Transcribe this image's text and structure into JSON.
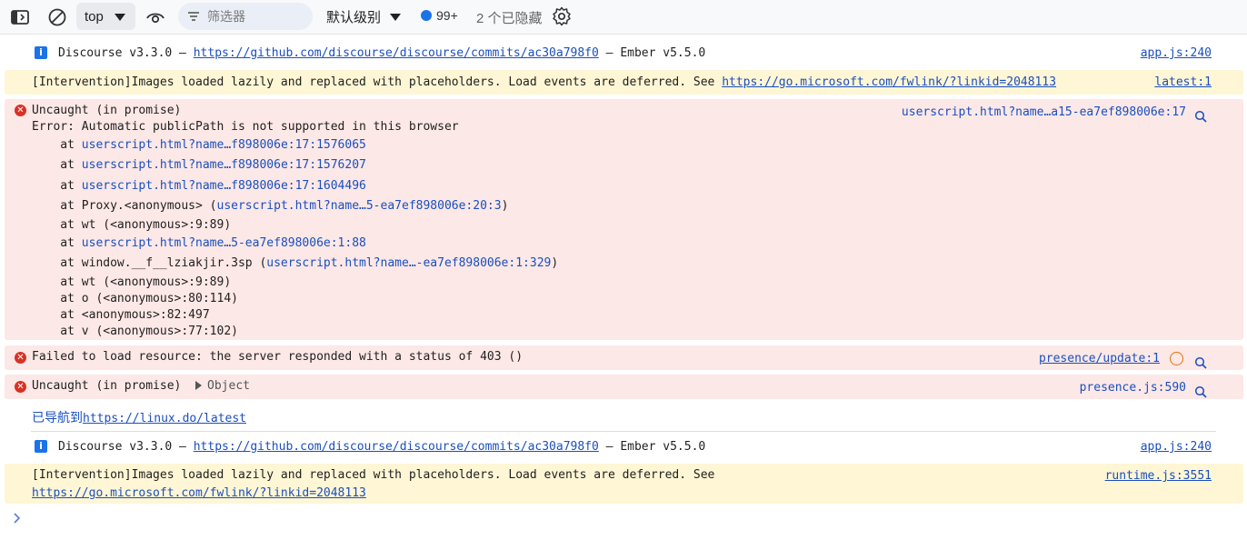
{
  "toolbar": {
    "context": "top",
    "filter_placeholder": "筛选器",
    "level": "默认级别",
    "issues_count": "99+",
    "hidden": "2 个已隐藏"
  },
  "messages": {
    "m1": {
      "text": "Discourse v3.3.0 — ",
      "link": "https://github.com/discourse/discourse/commits/ac30a798f0",
      "tail": " — Ember v5.5.0",
      "source": "app.js:240"
    },
    "m2": {
      "text": "[Intervention]Images loaded lazily and replaced with placeholders. Load events are deferred. See ",
      "link": "https://go.microsoft.com/fwlink/?linkid=2048113",
      "source": "latest:1"
    },
    "m3": {
      "title": "Uncaught (in promise)",
      "error": "Error: Automatic publicPath is not supported in this browser",
      "source": "userscript.html?name…a15-ea7ef898006e:17",
      "stack": {
        "s1": {
          "pre": "    at ",
          "link": "userscript.html?name…f898006e:17:1576065",
          "post": ""
        },
        "s2": {
          "pre": "    at ",
          "link": "userscript.html?name…f898006e:17:1576207",
          "post": ""
        },
        "s3": {
          "pre": "    at ",
          "link": "userscript.html?name…f898006e:17:1604496",
          "post": ""
        },
        "s4": {
          "pre": "    at Proxy.<anonymous> (",
          "link": "userscript.html?name…5-ea7ef898006e:20:3",
          "post": ")"
        },
        "s5": {
          "pre": "    at wt (<anonymous>:9:89)",
          "link": "",
          "post": ""
        },
        "s6": {
          "pre": "    at ",
          "link": "userscript.html?name…5-ea7ef898006e:1:88",
          "post": ""
        },
        "s7": {
          "pre": "    at window.__f__lziakjir.3sp (",
          "link": "userscript.html?name…-ea7ef898006e:1:329",
          "post": ")"
        },
        "s8": {
          "pre": "    at wt (<anonymous>:9:89)",
          "link": "",
          "post": ""
        },
        "s9": {
          "pre": "    at o (<anonymous>:80:114)",
          "link": "",
          "post": ""
        },
        "s10": {
          "pre": "    at <anonymous>:82:497",
          "link": "",
          "post": ""
        },
        "s11": {
          "pre": "    at v (<anonymous>:77:102)",
          "link": "",
          "post": ""
        }
      }
    },
    "m4": {
      "text": "Failed to load resource: the server responded with a status of 403 ()",
      "source": "presence/update:1"
    },
    "m5": {
      "text": "Uncaught (in promise)",
      "object": "Object",
      "source": "presence.js:590"
    },
    "m6": {
      "text": "已导航到",
      "link": "https://linux.do/latest"
    },
    "m7": {
      "text": "Discourse v3.3.0 — ",
      "link": "https://github.com/discourse/discourse/commits/ac30a798f0",
      "tail": " — Ember v5.5.0",
      "source": "app.js:240"
    },
    "m8": {
      "text": "[Intervention]Images loaded lazily and replaced with placeholders. Load events are deferred. See",
      "link": "https://go.microsoft.com/fwlink/?linkid=2048113",
      "source": "runtime.js:3551"
    }
  },
  "colors": {
    "link": "#1a4fbf",
    "error_bg": "#fce8e6",
    "warn_bg": "#fef6d5",
    "error_icon": "#d93025",
    "info_icon": "#1a73e8"
  }
}
